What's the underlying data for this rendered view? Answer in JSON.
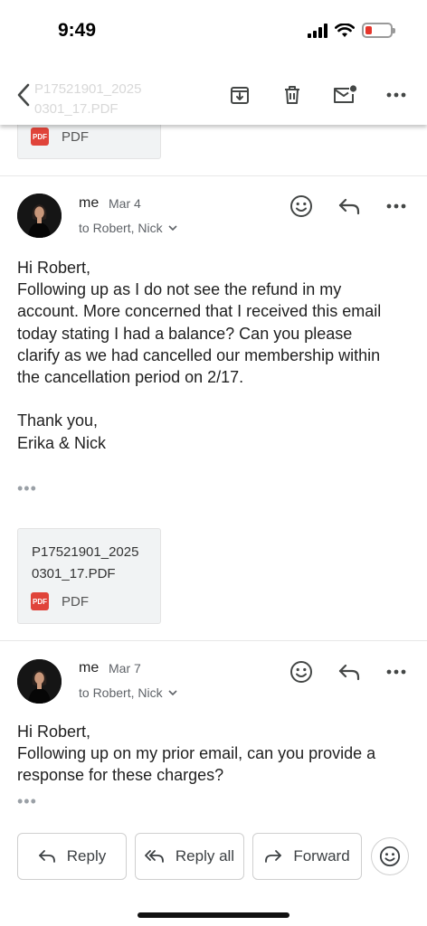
{
  "status_bar": {
    "time": "9:49"
  },
  "toolbar": {
    "back_icon": "chevron-left-icon",
    "icons": [
      "archive-icon",
      "trash-icon",
      "mark-unread-icon",
      "more-icon"
    ],
    "behind_text": "P17521901_2025 0301_17.PDF"
  },
  "top_attachment": {
    "type": "PDF"
  },
  "messages": [
    {
      "sender": "me",
      "date": "Mar 4",
      "recipients": "to Robert, Nick",
      "body": "Hi Robert,\nFollowing up as I do not see the refund in my account. More concerned that I received this email today stating I had a balance? Can you please clarify as we had cancelled our membership within the cancellation period on 2/17.\n\nThank you,\nErika & Nick",
      "attachment": {
        "name_line1": "P17521901_2025",
        "name_line2": "0301_17.PDF",
        "type": "PDF"
      }
    },
    {
      "sender": "me",
      "date": "Mar 7",
      "recipients": "to Robert, Nick",
      "body": "Hi Robert,\nFollowing up on my prior email, can you provide a response for these charges?"
    }
  ],
  "actions": {
    "reply": "Reply",
    "reply_all": "Reply all",
    "forward": "Forward"
  },
  "colors": {
    "pdf_badge": "#e0443a",
    "battery_low": "#e5352b",
    "icon_gray": "#444746"
  }
}
